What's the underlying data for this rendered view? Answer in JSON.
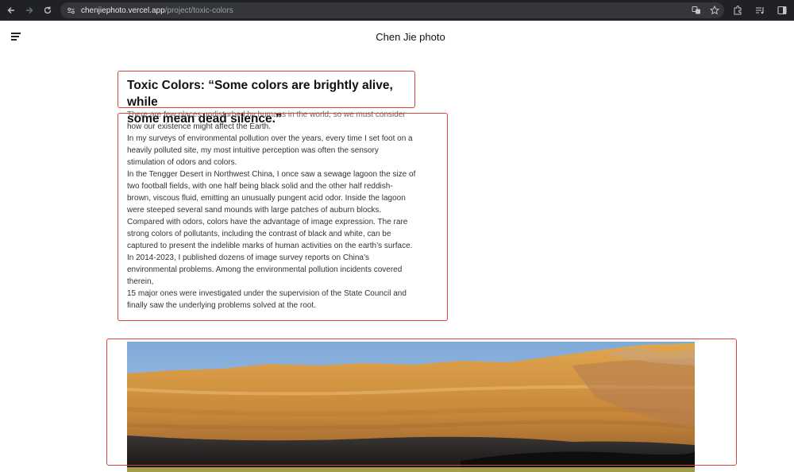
{
  "browser": {
    "url_host": "chenjiephoto.vercel.app",
    "url_path": "/project/toxic-colors",
    "icons": [
      "back-icon",
      "forward-icon",
      "reload-icon",
      "site-settings-icon",
      "translate-icon",
      "bookmark-star-icon",
      "extensions-icon",
      "media-icon",
      "sidebar-icon"
    ]
  },
  "header": {
    "site_title": "Chen Jie photo",
    "menu_icon": "hamburger-icon"
  },
  "article": {
    "title_line1": "Toxic Colors: “Some colors are brightly alive, while",
    "title_line2": "some mean dead silence.”",
    "lines": [
      "There are few places undisturbed by humans in the world, so we must consider",
      "how our existence might affect the Earth.",
      "In my surveys of environmental pollution over the years, every time I set foot on a",
      "heavily polluted site, my most intuitive perception was often the sensory",
      "stimulation of odors and colors.",
      "In the Tengger Desert in Northwest China, I once saw a sewage lagoon the size of",
      "two football fields, with one half being black solid and the other half reddish-",
      "brown, viscous fluid, emitting an unusually pungent acid odor. Inside the lagoon",
      "were steeped several sand mounds with large patches of auburn blocks.",
      "Compared with odors, colors have the advantage of image expression. The rare",
      "strong colors of pollutants, including the contrast of black and white, can be",
      "captured to present the indelible marks of human activities on the earth’s surface.",
      "In 2014-2023, I published dozens of image survey reports on China’s",
      "environmental problems. Among the environmental pollution incidents covered",
      "therein,",
      "15 major ones were investigated under the supervision of the State Council and",
      "finally saw the underlying problems solved at the root."
    ]
  },
  "colors": {
    "chrome_bg": "#202124",
    "omnibox_bg": "#35363a",
    "annotation": "#d9453a",
    "sky": "#8fb4dc",
    "cliff": "#d99a45"
  }
}
